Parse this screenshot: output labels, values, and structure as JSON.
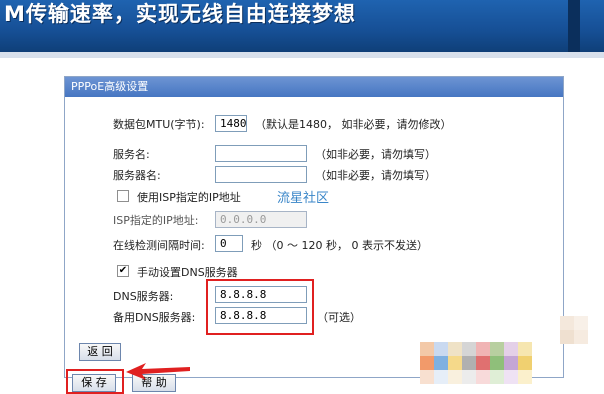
{
  "banner": {
    "text": "M传输速率，实现无线自由连接梦想"
  },
  "panel": {
    "title": "PPPoE高级设置",
    "mtu": {
      "label": "数据包MTU(字节):",
      "value": "1480",
      "note": "（默认是1480， 如非必要，请勿修改）"
    },
    "service_name": {
      "label": "服务名:",
      "value": "",
      "note": "（如非必要，请勿填写）"
    },
    "server_name": {
      "label": "服务器名:",
      "value": "",
      "note": "（如非必要，请勿填写）"
    },
    "use_isp_ip": {
      "label": "使用ISP指定的IP地址",
      "checked": false
    },
    "isp_ip": {
      "label": "ISP指定的IP地址:",
      "value": "0.0.0.0"
    },
    "interval": {
      "label": "在线检测间隔时间:",
      "value": "0",
      "note": "秒 （0 ～ 120 秒， 0 表示不发送）"
    },
    "manual_dns": {
      "label": "手动设置DNS服务器",
      "checked": true,
      "mark": "✔"
    },
    "dns": {
      "label": "DNS服务器:",
      "value": "8.8.8.8"
    },
    "alt_dns": {
      "label": "备用DNS服务器:",
      "value": "8.8.8.8",
      "note": "（可选）"
    },
    "back_label": "返 回",
    "save_label": "保 存",
    "help_label": "帮 助"
  },
  "watermark": "流星社区",
  "colors": {
    "highlight": "#e02020",
    "header": "#4676c2",
    "banner": "#164f95"
  }
}
